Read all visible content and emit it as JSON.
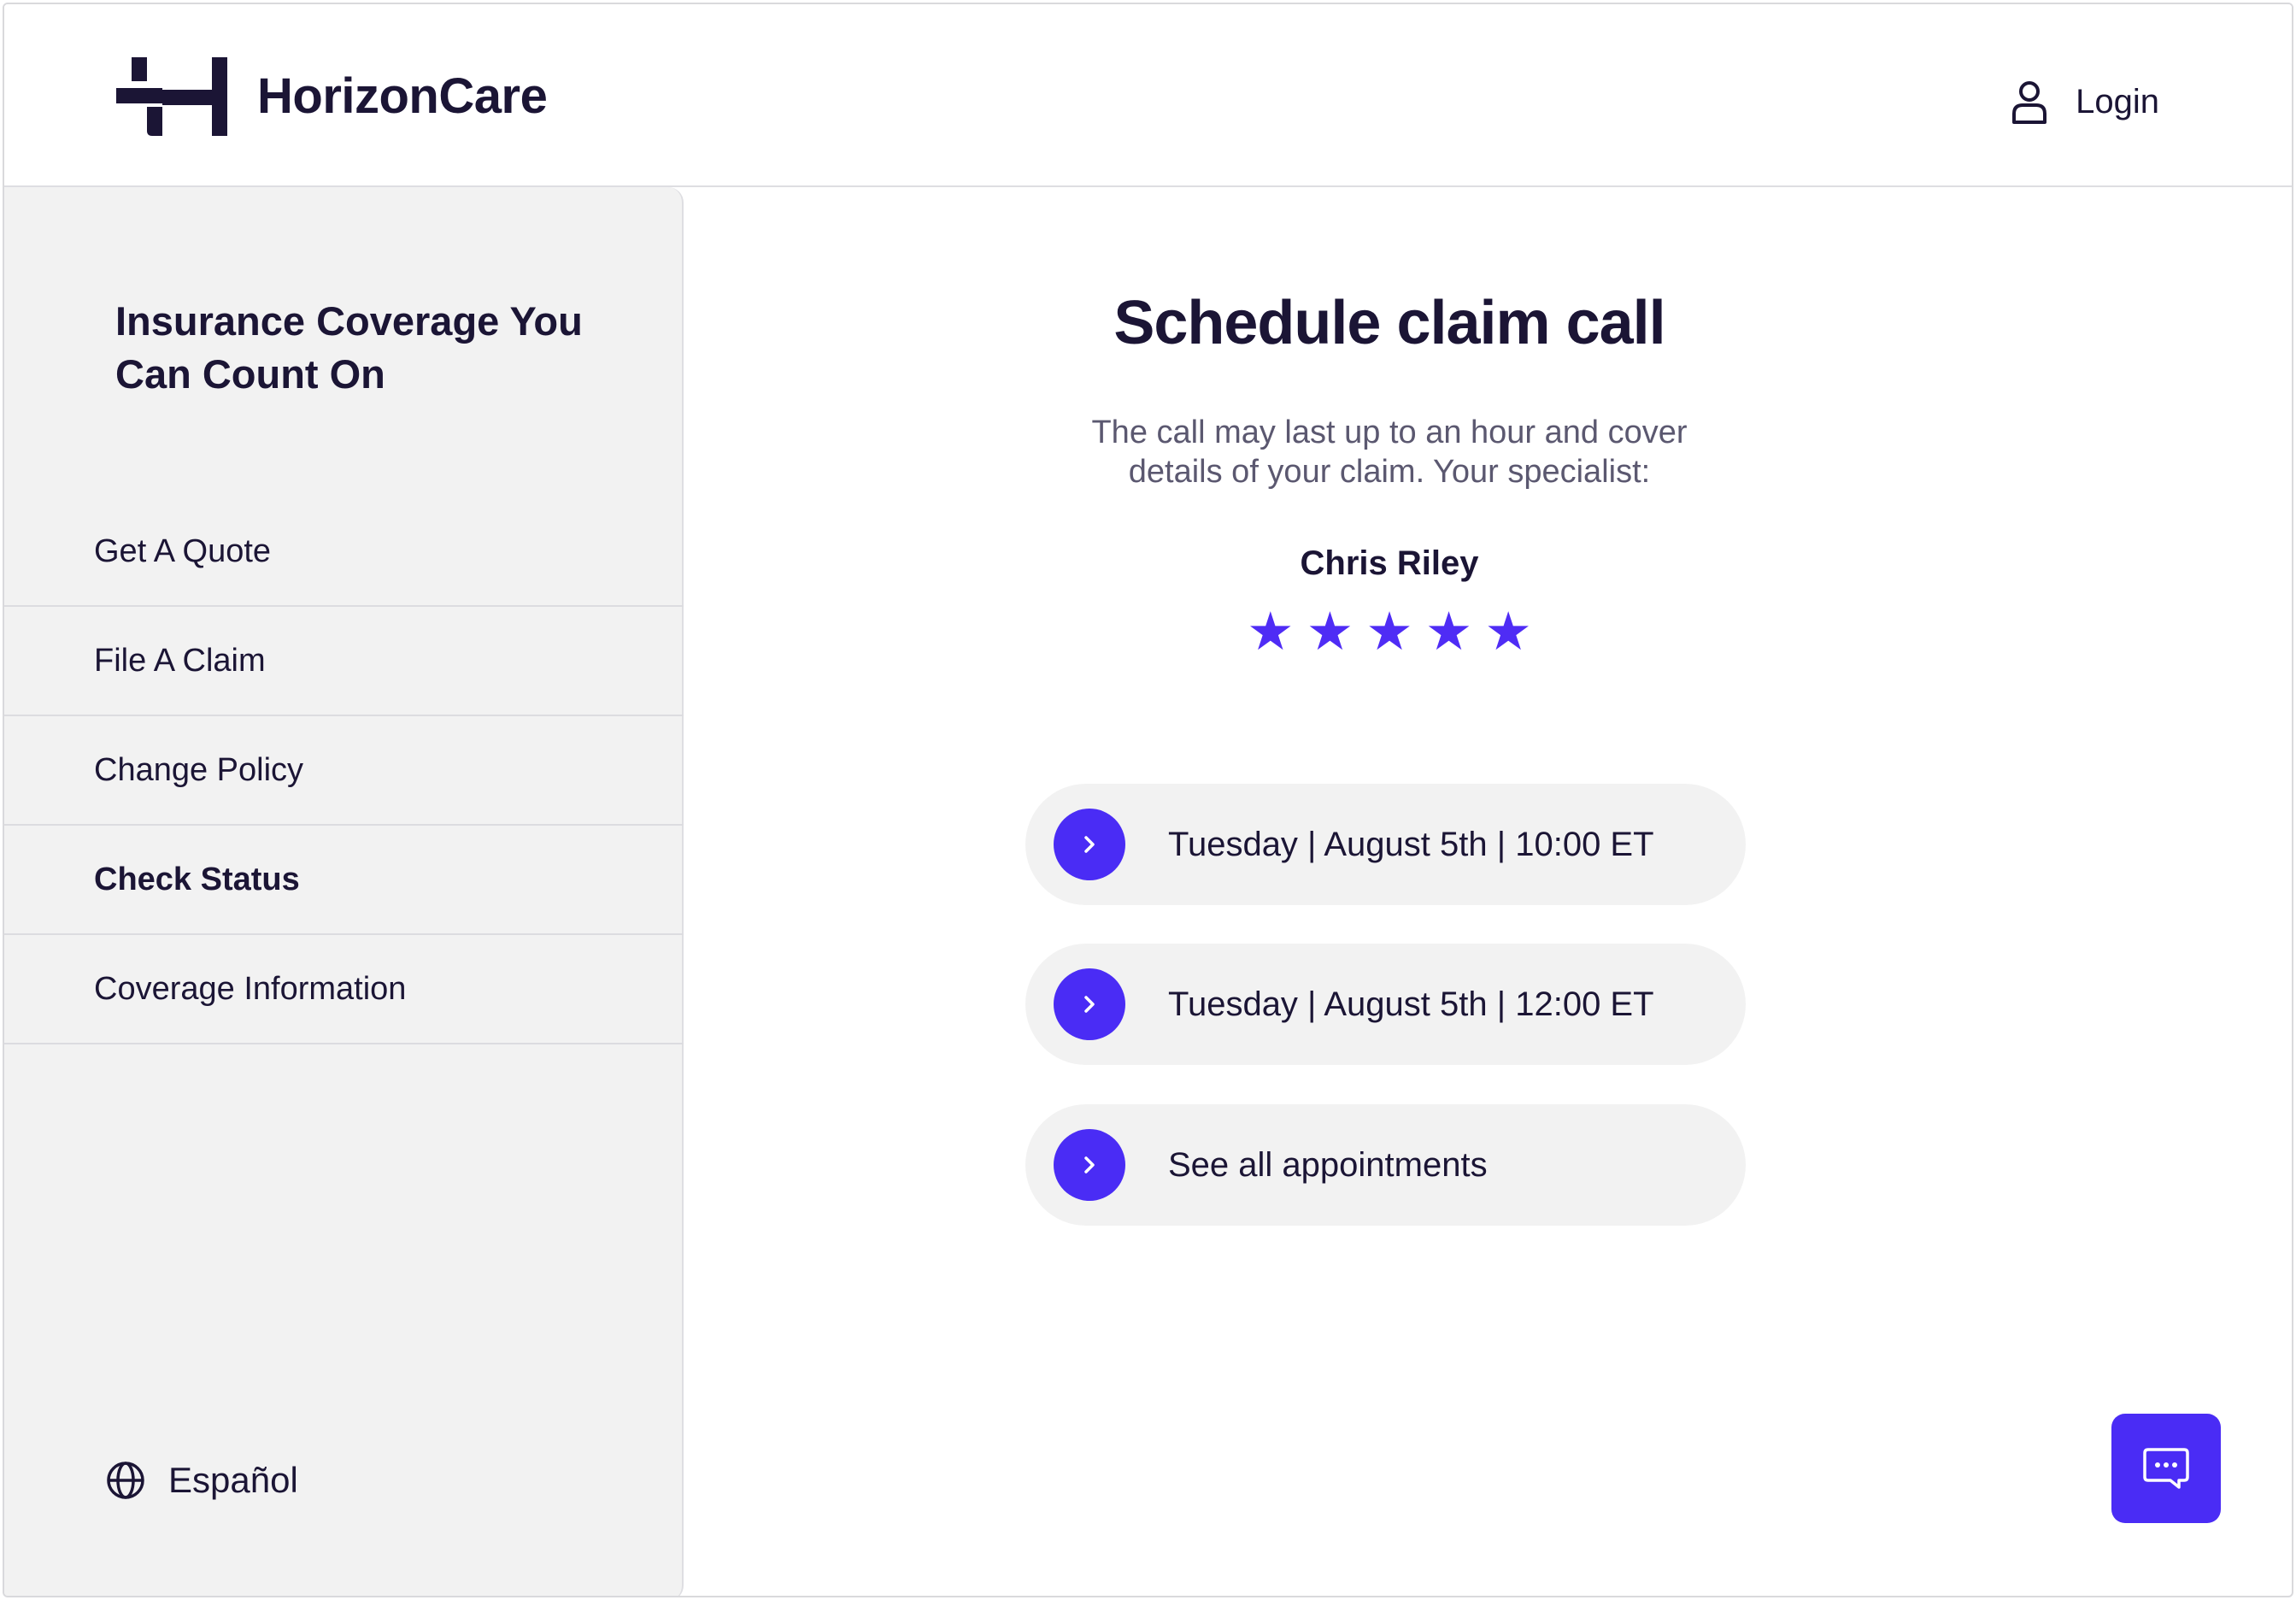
{
  "header": {
    "brand": "HorizonCare",
    "login_label": "Login"
  },
  "sidebar": {
    "tagline": "Insurance Coverage You Can Count On",
    "items": [
      {
        "label": "Get A Quote"
      },
      {
        "label": "File A Claim"
      },
      {
        "label": "Change Policy"
      },
      {
        "label": "Check Status"
      },
      {
        "label": "Coverage Information"
      }
    ],
    "language_label": "Español"
  },
  "main": {
    "title": "Schedule claim call",
    "description": "The call may last up to an hour and cover details of your claim. Your specialist:",
    "specialist_name": "Chris Riley",
    "rating": 5,
    "appointments": [
      {
        "label": "Tuesday | August 5th | 10:00 ET"
      },
      {
        "label": "Tuesday | August 5th | 12:00 ET"
      },
      {
        "label": "See all appointments"
      }
    ]
  },
  "icons": {
    "logo": "horizoncare-logo-icon",
    "login": "user-icon",
    "language": "globe-icon",
    "appointment": "chevron-right-icon",
    "chat": "chat-icon",
    "rating": "star-icon"
  },
  "colors": {
    "accent": "#4a2cf5",
    "text": "#1b1535",
    "muted_text": "#5b5870",
    "panel_bg": "#f2f2f2"
  }
}
